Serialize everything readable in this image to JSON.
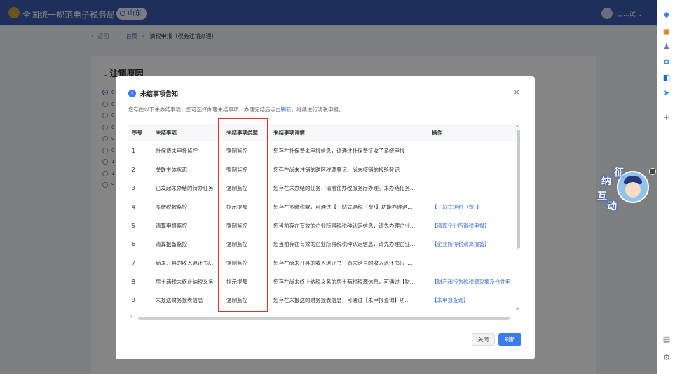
{
  "header": {
    "site_title": "全国统一规范电子税务局",
    "region": "山东",
    "user_name": "山...试"
  },
  "breadcrumb": {
    "back": "← 返回",
    "home": "首页",
    "separator": ">",
    "current": "清税申报（税务注销办理）"
  },
  "section": {
    "title": "注销原因",
    "options": [
      {
        "label": "0",
        "selected": true
      },
      {
        "label": "0",
        "selected": false
      },
      {
        "label": "0",
        "selected": false
      },
      {
        "label": "0",
        "selected": false
      },
      {
        "label": "0",
        "selected": false
      },
      {
        "label": "0",
        "selected": false
      },
      {
        "label": "1",
        "selected": false
      },
      {
        "label": "1",
        "selected": false
      },
      {
        "label": "9",
        "selected": false
      }
    ]
  },
  "mascot": {
    "chars": [
      "征",
      "纳",
      "互",
      "动"
    ]
  },
  "modal": {
    "title": "未结事项告知",
    "notice_before": "您存在以下未办结事项，您可选择办理未结事项，办理完结后点击",
    "notice_link": "刷新",
    "notice_after": "，继续进行清税申报。",
    "columns": [
      "序号",
      "未结事项",
      "未结事项类型",
      "未结事项详情",
      "操作"
    ],
    "rows": [
      {
        "no": "1",
        "item": "社保费未申报监控",
        "type": "强制监控",
        "detail": "您存在社保费未申报信息，请通过社保费征收子系统申报",
        "action": ""
      },
      {
        "no": "2",
        "item": "关联主体状态",
        "type": "强制监控",
        "detail": "您存在尚未注销的跨区税源登记、尚未核销的报验登记",
        "action": ""
      },
      {
        "no": "3",
        "item": "已发起未办结的待办任务",
        "type": "强制监控",
        "detail": "您存在未办结的任务，请前往办税服务厅办理。未办结任务...",
        "action": ""
      },
      {
        "no": "4",
        "item": "多缴税款监控",
        "type": "提示提醒",
        "detail": "您存在多缴税款，可通过【一站式退税（费）】功能办理退...",
        "action": "【一站式退税（费）】"
      },
      {
        "no": "5",
        "item": "清算申报监控",
        "type": "强制监控",
        "detail": "您当前存在有效的企业所得税税种认定信息，请先办理企业...",
        "action": "【清算企业所得税申报】"
      },
      {
        "no": "6",
        "item": "清算报备监控",
        "type": "强制监控",
        "detail": "您当前存在有效的企业所得税税种认定信息，请先办理企业...",
        "action": "【企业所得税清算报备】"
      },
      {
        "no": "7",
        "item": "尚未开具的收入退还书/...",
        "type": "强制监控",
        "detail": "您存在尚未开具的收入退还书（尚未销号的收入退还书），...",
        "action": ""
      },
      {
        "no": "8",
        "item": "房土两税未终止纳税义务",
        "type": "提示提醒",
        "detail": "您存在尚未终止纳税义务的房土两税税源信息，可通过【财...",
        "action": "【财产和行为税税源采集及合并申"
      },
      {
        "no": "9",
        "item": "未报送财务报表信息",
        "type": "强制监控",
        "detail": "您存在未报送的财务报表信息，可通过【未申报查询】功...",
        "action": "【未申报查询】"
      }
    ],
    "buttons": {
      "close": "关闭",
      "refresh": "刷新"
    }
  },
  "colors": {
    "primary": "#3b7bea",
    "header_bg": "#3b5bb0",
    "highlight": "#e0312e",
    "link": "#3b6fd8"
  },
  "icons": [
    "info-icon",
    "close-icon",
    "location-pin-icon",
    "avatar",
    "chevron-down-icon",
    "tag-icon",
    "briefcase-icon",
    "people-icon",
    "settings-wheel-icon",
    "outlook-icon",
    "bird-icon",
    "plus-icon",
    "screen-icon",
    "gear-icon"
  ]
}
